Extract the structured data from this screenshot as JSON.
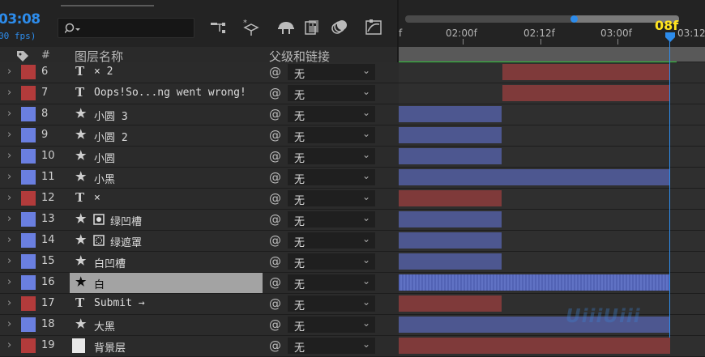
{
  "header": {
    "timecode": "03:08",
    "fps": "00 fps)",
    "col_num": "#",
    "col_layer_name": "图层名称",
    "col_parent": "父级和链接"
  },
  "toolbar_icons": [
    "flowchart-icon",
    "solo-sparkle-icon",
    "shy-layer-icon",
    "frame-blend-icon",
    "motion-blur-icon",
    "graph-editor-icon"
  ],
  "ruler": {
    "ticks": [
      "f",
      "02:00f",
      "02:12f",
      "03:00f",
      "03:12"
    ],
    "playhead_label": "08f"
  },
  "layers": [
    {
      "num": "6",
      "type": "T",
      "name": "× 2",
      "color": "#b23b3b",
      "bar_start": 0.338,
      "bar_end": 0.885,
      "bar_color": "#7f3a3a",
      "selected": false
    },
    {
      "num": "7",
      "type": "T",
      "name": "Oops!So...ng went wrong!",
      "color": "#b23b3b",
      "bar_start": 0.338,
      "bar_end": 0.885,
      "bar_color": "#7f3a3a",
      "selected": false
    },
    {
      "num": "8",
      "type": "★",
      "name": "小圆 3",
      "color": "#6a7fe0",
      "bar_start": 0.0,
      "bar_end": 0.335,
      "bar_color": "#4d5790",
      "selected": false
    },
    {
      "num": "9",
      "type": "★",
      "name": "小圆 2",
      "color": "#6a7fe0",
      "bar_start": 0.0,
      "bar_end": 0.335,
      "bar_color": "#4d5790",
      "selected": false
    },
    {
      "num": "10",
      "type": "★",
      "name": "小圆",
      "color": "#6a7fe0",
      "bar_start": 0.0,
      "bar_end": 0.335,
      "bar_color": "#4d5790",
      "selected": false
    },
    {
      "num": "11",
      "type": "★",
      "name": "小黑",
      "color": "#6a7fe0",
      "bar_start": 0.0,
      "bar_end": 0.885,
      "bar_color": "#4d5790",
      "selected": false
    },
    {
      "num": "12",
      "type": "T",
      "name": "×",
      "color": "#b23b3b",
      "bar_start": 0.0,
      "bar_end": 0.335,
      "bar_color": "#7f3a3a",
      "selected": false
    },
    {
      "num": "13",
      "type": "★",
      "name": "绿凹槽",
      "color": "#6a7fe0",
      "bar_start": 0.0,
      "bar_end": 0.335,
      "bar_color": "#4d5790",
      "selected": false,
      "mask": "mask-icon"
    },
    {
      "num": "14",
      "type": "★",
      "name": "绿遮罩",
      "color": "#6a7fe0",
      "bar_start": 0.0,
      "bar_end": 0.335,
      "bar_color": "#4d5790",
      "selected": false,
      "mask": "mask-dotted-icon"
    },
    {
      "num": "15",
      "type": "★",
      "name": "白凹槽",
      "color": "#6a7fe0",
      "bar_start": 0.0,
      "bar_end": 0.335,
      "bar_color": "#4d5790",
      "selected": false
    },
    {
      "num": "16",
      "type": "★",
      "name": "白",
      "color": "#6a7fe0",
      "bar_start": 0.0,
      "bar_end": 0.885,
      "bar_color": "#5263b5",
      "selected": true
    },
    {
      "num": "17",
      "type": "T",
      "name": "Submit →",
      "color": "#b23b3b",
      "bar_start": 0.0,
      "bar_end": 0.335,
      "bar_color": "#7f3a3a",
      "selected": false
    },
    {
      "num": "18",
      "type": "★",
      "name": "大黑",
      "color": "#6a7fe0",
      "bar_start": 0.0,
      "bar_end": 0.885,
      "bar_color": "#4d5790",
      "selected": false
    },
    {
      "num": "19",
      "type": "▭",
      "name": "背景层",
      "color": "#b23b3b",
      "bar_start": 0.0,
      "bar_end": 0.885,
      "bar_color": "#7f3a3a",
      "selected": false
    }
  ],
  "parent_value": "无",
  "watermark": "UiiiUiii"
}
